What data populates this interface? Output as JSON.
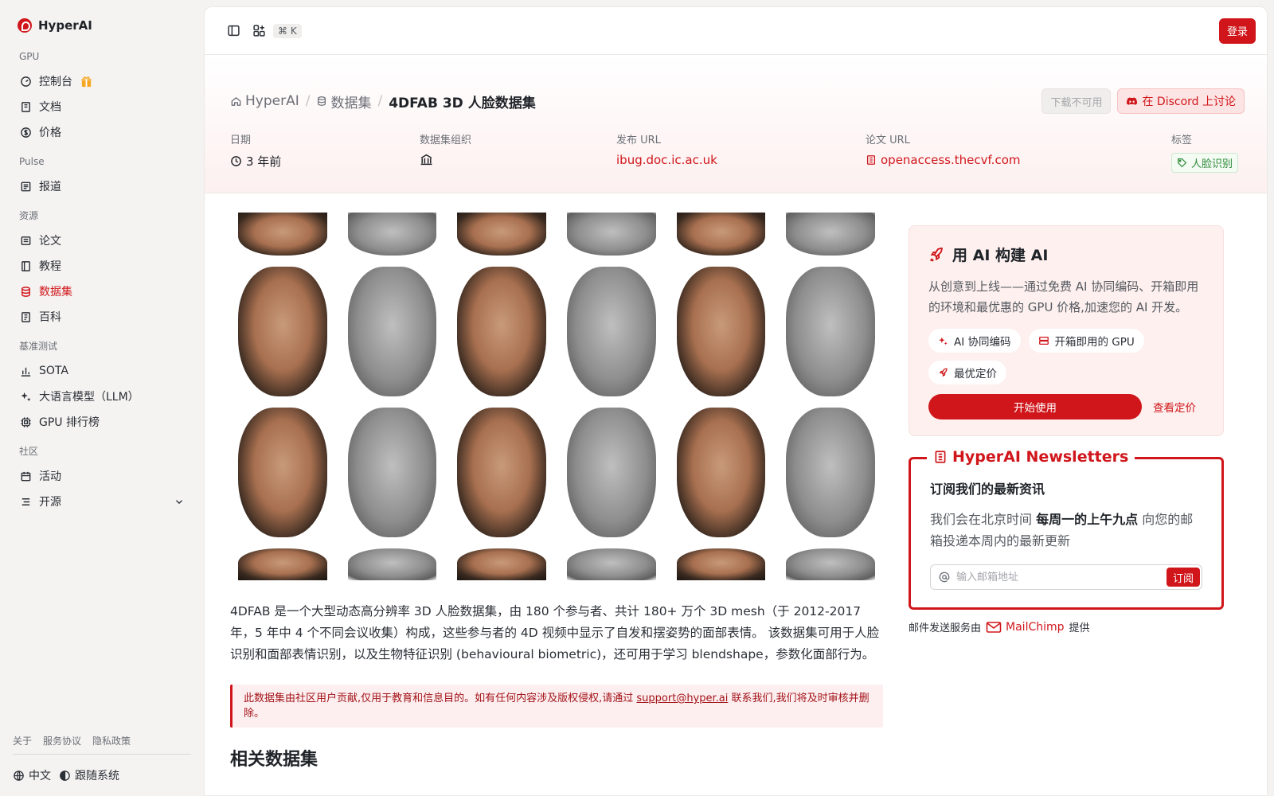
{
  "brand": {
    "name": "HyperAI"
  },
  "sidebar": {
    "groups": [
      {
        "label": "GPU",
        "items": [
          {
            "label": "控制台",
            "icon": "dashboard-icon"
          },
          {
            "label": "文档",
            "icon": "book-icon"
          },
          {
            "label": "价格",
            "icon": "dollar-icon"
          }
        ]
      },
      {
        "label": "Pulse",
        "items": [
          {
            "label": "报道",
            "icon": "newspaper-icon"
          }
        ]
      },
      {
        "label": "资源",
        "items": [
          {
            "label": "论文",
            "icon": "paper-icon"
          },
          {
            "label": "教程",
            "icon": "tutorial-icon"
          },
          {
            "label": "数据集",
            "icon": "database-icon",
            "active": true
          },
          {
            "label": "百科",
            "icon": "wiki-icon"
          }
        ]
      },
      {
        "label": "基准测试",
        "items": [
          {
            "label": "SOTA",
            "icon": "bar-chart-icon"
          },
          {
            "label": "大语言模型（LLM）",
            "icon": "sparkles-icon"
          },
          {
            "label": "GPU 排行榜",
            "icon": "cpu-icon"
          }
        ]
      },
      {
        "label": "社区",
        "items": [
          {
            "label": "活动",
            "icon": "calendar-icon"
          },
          {
            "label": "开源",
            "icon": "list-icon"
          }
        ]
      }
    ],
    "footer_links": [
      "关于",
      "服务协议",
      "隐私政策"
    ],
    "language": "中文",
    "theme": "跟随系统"
  },
  "topbar": {
    "shortcut": "⌘ K",
    "login": "登录"
  },
  "breadcrumb": {
    "root": "HyperAI",
    "section": "数据集",
    "current": "4DFAB 3D 人脸数据集"
  },
  "hero_actions": {
    "download": "下载不可用",
    "discord": "在 Discord 上讨论"
  },
  "meta": {
    "date_label": "日期",
    "date_value": "3 年前",
    "org_label": "数据集组织",
    "url_label": "发布 URL",
    "url_value": "ibug.doc.ic.ac.uk",
    "paper_label": "论文 URL",
    "paper_value": "openaccess.thecvf.com",
    "tags_label": "标签",
    "tag_value": "人脸识别"
  },
  "description": "4DFAB 是一个大型动态高分辨率 3D 人脸数据集，由 180 个参与者、共计 180+ 万个 3D mesh（于 2012-2017 年，5 年中 4 个不同会议收集）构成，这些参与者的 4D 视频中显示了自发和摆姿势的面部表情。 该数据集可用于人脸识别和面部表情识别，以及生物特征识别 (behavioural biometric)，还可用于学习 blendshape，参数化面部行为。",
  "notice": {
    "before": "此数据集由社区用户贡献,仅用于教育和信息目的。如有任何内容涉及版权侵权,请通过 ",
    "email": "support@hyper.ai",
    "after": " 联系我们,我们将及时审核并删除。"
  },
  "related_title": "相关数据集",
  "promo": {
    "title": "用 AI 构建 AI",
    "text": "从创意到上线——通过免费 AI 协同编码、开箱即用的环境和最优惠的 GPU 价格,加速您的 AI 开发。",
    "pills": [
      "AI 协同编码",
      "开箱即用的 GPU",
      "最优定价"
    ],
    "start": "开始使用",
    "pricing": "查看定价"
  },
  "newsletter": {
    "legend": "HyperAI Newsletters",
    "title": "订阅我们的最新资讯",
    "text_before": "我们会在北京时间 ",
    "text_bold": "每周一的上午九点",
    "text_after": " 向您的邮箱投递本周内的最新更新",
    "placeholder": "输入邮箱地址",
    "subscribe": "订阅",
    "powered_before": "邮件发送服务由",
    "powered_brand": "MailChimp",
    "powered_after": "提供"
  },
  "colors": {
    "accent": "#d0161b",
    "tag_green": "#2f8a3a"
  }
}
